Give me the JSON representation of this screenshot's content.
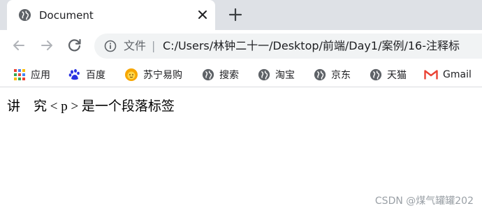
{
  "tab": {
    "title": "Document",
    "favicon": "globe-icon"
  },
  "toolbar": {
    "omnibox_label": "文件",
    "omnibox_separator": "|",
    "url": "C:/Users/林钟二十一/Desktop/前端/Day1/案例/16-注释标"
  },
  "bookmarks": {
    "items": [
      {
        "label": "应用",
        "icon": "apps-grid-icon"
      },
      {
        "label": "百度",
        "icon": "baidu-paw-icon"
      },
      {
        "label": "苏宁易购",
        "icon": "suning-lion-icon"
      },
      {
        "label": "搜索",
        "icon": "globe-icon"
      },
      {
        "label": "淘宝",
        "icon": "globe-icon"
      },
      {
        "label": "京东",
        "icon": "globe-icon"
      },
      {
        "label": "天猫",
        "icon": "globe-icon"
      },
      {
        "label": "Gmail",
        "icon": "gmail-icon"
      }
    ]
  },
  "page": {
    "text": "讲    究 < p > 是一个段落标签"
  },
  "watermark": "CSDN @煤气罐罐202",
  "colors": {
    "tabstrip_bg": "#dee1e6",
    "omnibox_bg": "#f1f3f4",
    "icon_gray": "#5f6368",
    "gmail_red": "#ea4335"
  }
}
